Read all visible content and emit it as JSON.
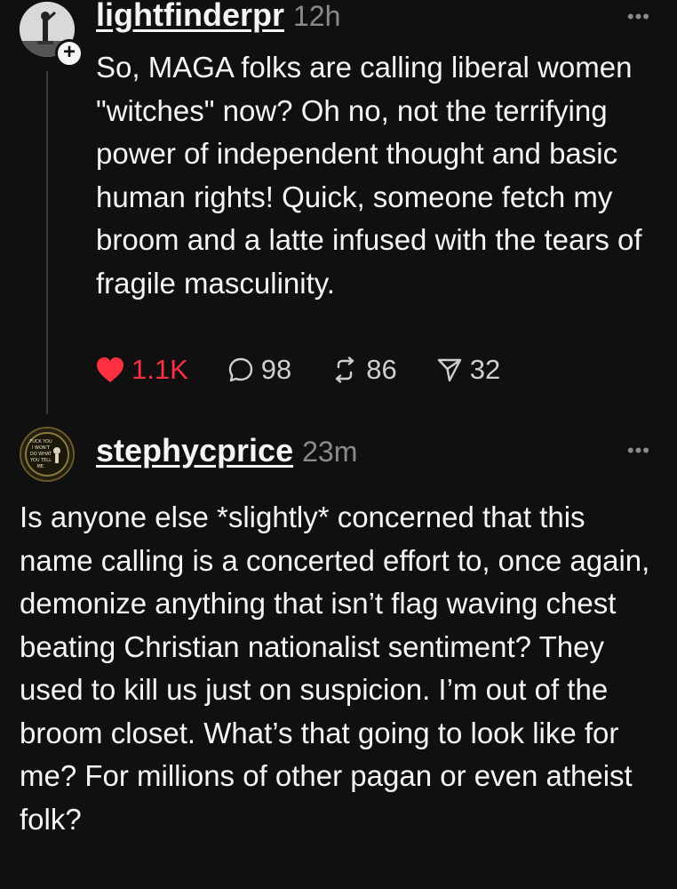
{
  "posts": [
    {
      "username": "lightfinderpr",
      "time": "12h",
      "more": "•••",
      "text": "So, MAGA folks are calling liberal women \"witches\" now? Oh no, not the terrifying power of independent thought and basic human rights! Quick, someone fetch my broom and a latte infused with the tears of fragile masculinity.",
      "likes": "1.1K",
      "replies": "98",
      "reposts": "86",
      "shares": "32",
      "follow_label": "+"
    },
    {
      "username": "stephycprice",
      "time": "23m",
      "more": "•••",
      "text": "Is anyone else *slightly* concerned that this name calling is a concerted effort to, once again, demonize anything that isn’t flag waving chest beating Christian nationalist sentiment? They used to kill us just on suspicion. I’m out of the broom closet. What’s that going to look like for me? For millions of other pagan or even atheist folk?",
      "avatar_text": [
        "FUCK YOU",
        "I WON'T",
        "DO WHAT",
        "YOU TELL",
        "ME."
      ]
    }
  ],
  "colors": {
    "background": "#101010",
    "text": "#f3f5f7",
    "muted": "#8a8a8a",
    "like": "#ff3040"
  },
  "icons": {
    "like": "heart-icon",
    "reply": "comment-icon",
    "repost": "repost-icon",
    "share": "share-icon"
  }
}
